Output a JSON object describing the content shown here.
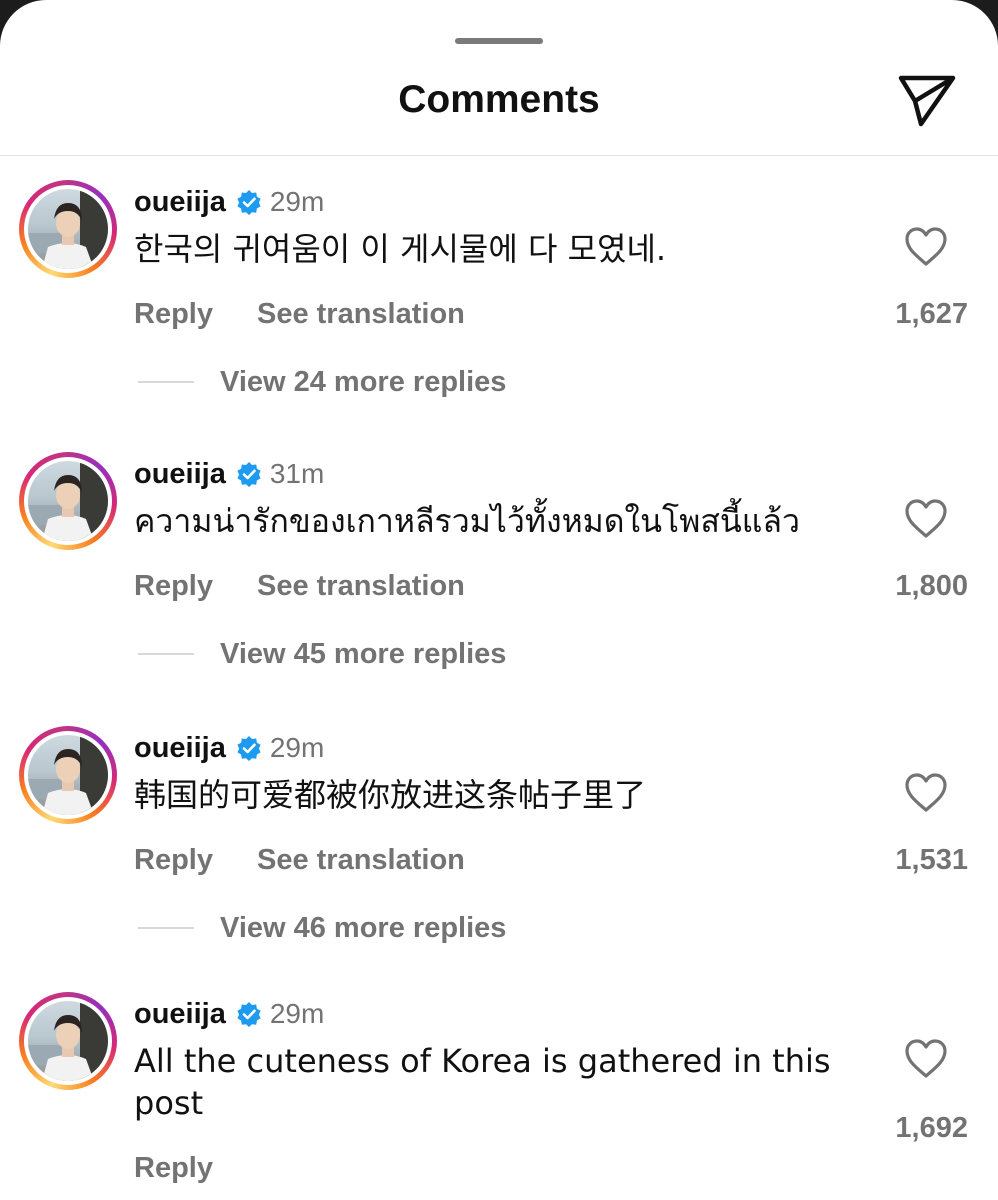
{
  "header": {
    "title": "Comments",
    "send_icon": "paper-plane-icon"
  },
  "colors": {
    "background": "#ffffff",
    "text_primary": "#111111",
    "text_secondary": "#737373",
    "verified_blue": "#1d9bf0",
    "story_ring": [
      "#feda75",
      "#fa7e1e",
      "#d62976",
      "#962fbf"
    ]
  },
  "labels": {
    "reply": "Reply",
    "see_translation": "See translation"
  },
  "comments": [
    {
      "username": "oueiija",
      "verified": true,
      "time": "29m",
      "text": "한국의 귀여움이 이 게시물에 다 모였네.",
      "likes": "1,627",
      "view_replies": "View 24 more replies"
    },
    {
      "username": "oueiija",
      "verified": true,
      "time": "31m",
      "text": "ความน่ารักของเกาหลีรวมไว้ทั้งหมดในโพสนี้แล้ว",
      "likes": "1,800",
      "view_replies": "View 45 more replies"
    },
    {
      "username": "oueiija",
      "verified": true,
      "time": "29m",
      "text": "韩国的可爱都被你放进这条帖子里了",
      "likes": "1,531",
      "view_replies": "View 46 more replies"
    },
    {
      "username": "oueiija",
      "verified": true,
      "time": "29m",
      "text": "All the cuteness of Korea is gathered in this post",
      "likes": "1,692"
    }
  ]
}
